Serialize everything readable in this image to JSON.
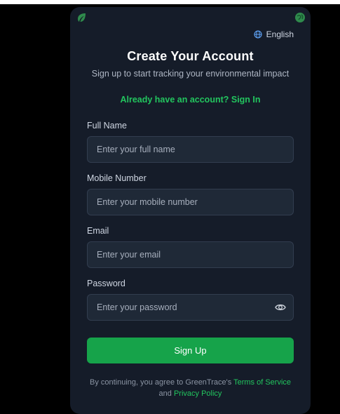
{
  "language": {
    "label": "English",
    "icon": "globe-icon"
  },
  "heading": {
    "title": "Create Your Account",
    "subtitle": "Sign up to start tracking your environmental impact"
  },
  "signin_link": "Already have an account? Sign In",
  "fields": {
    "full_name": {
      "label": "Full Name",
      "placeholder": "Enter your full name",
      "value": ""
    },
    "mobile": {
      "label": "Mobile Number",
      "placeholder": "Enter your mobile number",
      "value": ""
    },
    "email": {
      "label": "Email",
      "placeholder": "Enter your email",
      "value": ""
    },
    "password": {
      "label": "Password",
      "placeholder": "Enter your password",
      "value": ""
    }
  },
  "submit_label": "Sign Up",
  "terms": {
    "prefix": "By continuing, you agree to GreenTrace's",
    "terms_link": "Terms of Service",
    "conjunction": "and",
    "privacy_link": "Privacy Policy"
  },
  "colors": {
    "page_bg": "#000000",
    "card_bg": "#151c29",
    "input_bg": "#1f2937",
    "accent": "#22c55e",
    "button": "#16a34a"
  },
  "icons": [
    "leaf-icon",
    "globe-icon",
    "eye-icon"
  ]
}
